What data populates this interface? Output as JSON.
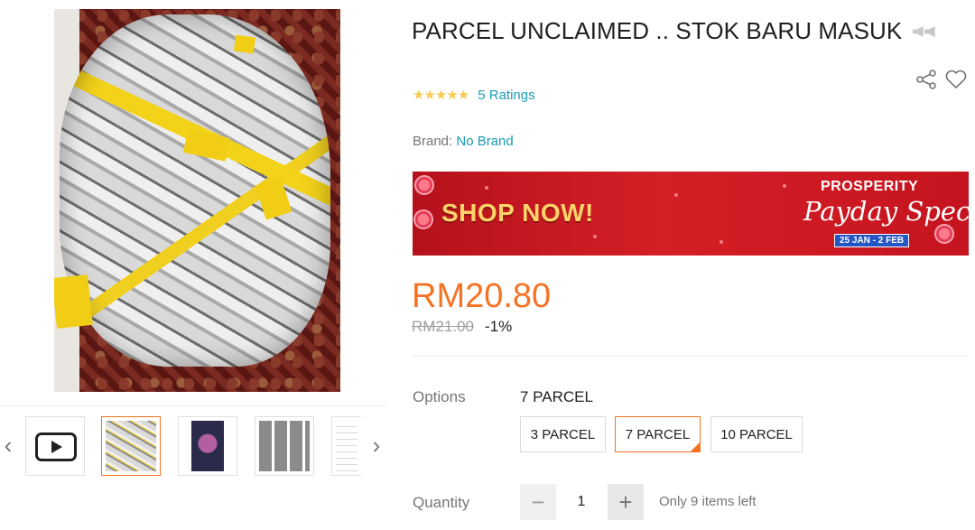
{
  "product": {
    "title": "PARCEL UNCLAIMED .. STOK BARU MASUK",
    "title_emoji_icon": "megaphone-icon",
    "ratings_label": "5 Ratings",
    "star_count": 5,
    "brand_label": "Brand:",
    "brand_value": "No Brand"
  },
  "banner": {
    "cta": "SHOP NOW!",
    "campaign_top": "PROSPERITY",
    "campaign_main": "Payday Special",
    "dates": "25 JAN - 2 FEB"
  },
  "pricing": {
    "price": "RM20.80",
    "original_price": "RM21.00",
    "discount": "-1%"
  },
  "options": {
    "label": "Options",
    "selected_value": "7 PARCEL",
    "choices": [
      "3 PARCEL",
      "7 PARCEL",
      "10 PARCEL"
    ],
    "selected_index": 1
  },
  "quantity": {
    "label": "Quantity",
    "minus": "−",
    "plus": "+",
    "value": "1",
    "stock_note": "Only 9 items left"
  },
  "gallery": {
    "prev": "‹",
    "next": "›",
    "thumbnail_count_visible": 5,
    "active_index": 1
  },
  "colors": {
    "accent": "#f57224",
    "link": "#1a9cb7",
    "star": "#faca51",
    "banner": "#c8141f"
  }
}
